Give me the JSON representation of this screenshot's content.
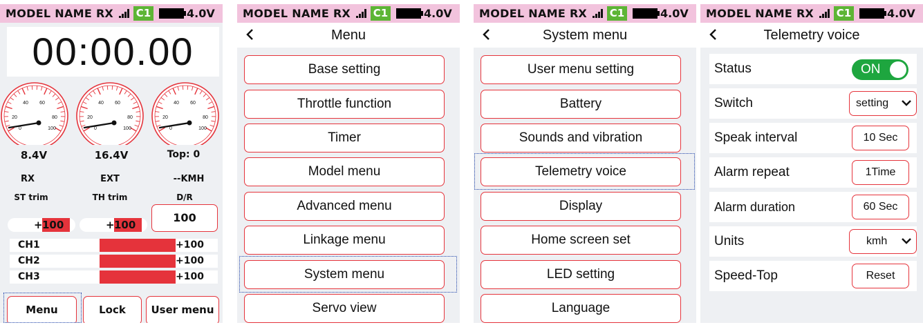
{
  "status_bar": {
    "model_name": "MODEL NAME",
    "rx_label": "RX",
    "receiver_badge": "C1",
    "battery_voltage": "4.0V",
    "signal_icon": "signal-bars-icon",
    "battery_icon": "battery-icon"
  },
  "colors": {
    "status_bar_bg": "#f2c3dd",
    "accent_red": "#e5333b",
    "badge_green": "#5db535",
    "toggle_green": "#1ea63f",
    "screen_bg": "#eef0f3",
    "selection_outline": "#1a3fa8"
  },
  "home": {
    "timer": "00:00.00",
    "gauges": [
      {
        "name": "rx-voltage",
        "ticks": [
          "20",
          "40",
          "60",
          "80",
          "100",
          "0"
        ]
      },
      {
        "name": "ext-voltage",
        "ticks": [
          "20",
          "40",
          "60",
          "80",
          "100",
          "0"
        ]
      },
      {
        "name": "speed",
        "ticks": [
          "20",
          "40",
          "60",
          "80",
          "100",
          "0"
        ]
      }
    ],
    "rx_voltage": "8.4V",
    "ext_voltage": "16.4V",
    "top_speed_label": "Top",
    "top_speed_value": "0",
    "rx_label": "RX",
    "ext_label": "EXT",
    "speed_unit": "--KMH",
    "st_trim_label": "ST trim",
    "th_trim_label": "TH trim",
    "dr_label": "D/R",
    "st_trim_sign": "+",
    "st_trim_value": "100",
    "th_trim_sign": "+",
    "th_trim_value": "100",
    "dr_value": "100",
    "channels": [
      {
        "name": "CH1",
        "value": "+100",
        "level": 1.0
      },
      {
        "name": "CH2",
        "value": "+100",
        "level": 1.0
      },
      {
        "name": "CH3",
        "value": "+100",
        "level": 1.0
      }
    ],
    "buttons": {
      "menu": "Menu",
      "lock": "Lock",
      "user_menu": "User menu"
    }
  },
  "menu": {
    "title": "Menu",
    "items": [
      "Base setting",
      "Throttle function",
      "Timer",
      "Model menu",
      "Advanced menu",
      "Linkage menu",
      "System menu",
      "Servo view"
    ],
    "highlighted": "System menu"
  },
  "system_menu": {
    "title": "System menu",
    "items": [
      "User menu setting",
      "Battery",
      "Sounds and vibration",
      "Telemetry voice",
      "Display",
      "Home screen set",
      "LED setting",
      "Language"
    ],
    "highlighted": "Telemetry voice"
  },
  "telemetry": {
    "title": "Telemetry voice",
    "rows": [
      {
        "label": "Status",
        "value": "ON",
        "control": "toggle"
      },
      {
        "label": "Switch",
        "value": "setting",
        "control": "dropdown"
      },
      {
        "label": "Speak interval",
        "value": "10 Sec",
        "control": "button"
      },
      {
        "label": "Alarm repeat",
        "value": "1Time",
        "control": "button"
      },
      {
        "label": "Alarm duration",
        "value": "60 Sec",
        "control": "button"
      },
      {
        "label": "Units",
        "value": "kmh",
        "control": "dropdown"
      },
      {
        "label": "Speed-Top",
        "value": "Reset",
        "control": "button"
      }
    ]
  }
}
